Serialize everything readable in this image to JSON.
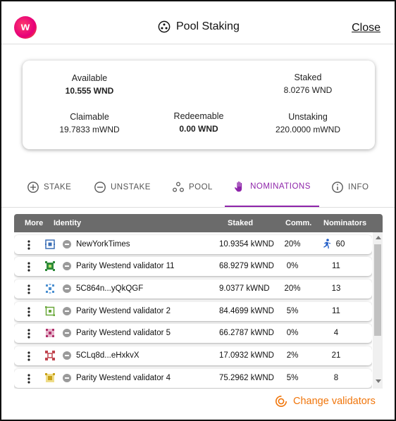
{
  "header": {
    "logo_letter": "w",
    "title": "Pool Staking",
    "close_label": "Close"
  },
  "balances": {
    "available": {
      "label": "Available",
      "value": "10.555 WND"
    },
    "staked": {
      "label": "Staked",
      "value": "8.0276 WND"
    },
    "claimable": {
      "label": "Claimable",
      "value": "19.7833 mWND"
    },
    "redeemable": {
      "label": "Redeemable",
      "value": "0.00 WND"
    },
    "unstaking": {
      "label": "Unstaking",
      "value": "220.0000 mWND"
    }
  },
  "tabs": [
    {
      "label": "STAKE",
      "icon": "plus-circle-icon"
    },
    {
      "label": "UNSTAKE",
      "icon": "minus-circle-icon"
    },
    {
      "label": "POOL",
      "icon": "pool-icon"
    },
    {
      "label": "NOMINATIONS",
      "icon": "hand-icon",
      "active": true
    },
    {
      "label": "INFO",
      "icon": "info-icon"
    }
  ],
  "table": {
    "columns": {
      "more": "More",
      "identity": "Identity",
      "staked": "Staked",
      "comm": "Comm.",
      "nominators": "Nominators"
    },
    "rows": [
      {
        "name": "NewYorkTimes",
        "staked": "10.9354 kWND",
        "comm": "20%",
        "nominators": "60",
        "oversubscribed": true,
        "identicon": "#3b6fb6"
      },
      {
        "name": "Parity Westend validator 11",
        "staked": "68.9279 kWND",
        "comm": "0%",
        "nominators": "11",
        "identicon": "#2e8b3a"
      },
      {
        "name": "5C864n...yQkQGF",
        "staked": "9.0377 kWND",
        "comm": "20%",
        "nominators": "13",
        "identicon": "#4a8fd0"
      },
      {
        "name": "Parity Westend validator 2",
        "staked": "84.4699 kWND",
        "comm": "5%",
        "nominators": "11",
        "identicon": "#6aa83b"
      },
      {
        "name": "Parity Westend validator 5",
        "staked": "66.2787 kWND",
        "comm": "0%",
        "nominators": "4",
        "identicon": "#b0306a"
      },
      {
        "name": "5CLq8d...eHxkvX",
        "staked": "17.0932 kWND",
        "comm": "2%",
        "nominators": "21",
        "identicon": "#c0444e"
      },
      {
        "name": "Parity Westend validator 4",
        "staked": "75.2962 kWND",
        "comm": "5%",
        "nominators": "8",
        "identicon": "#c9a21a"
      }
    ]
  },
  "footer": {
    "change_label": "Change validators"
  },
  "colors": {
    "accent": "#8e24aa",
    "orange": "#f0750a",
    "header_bg": "#6b6b6b"
  }
}
